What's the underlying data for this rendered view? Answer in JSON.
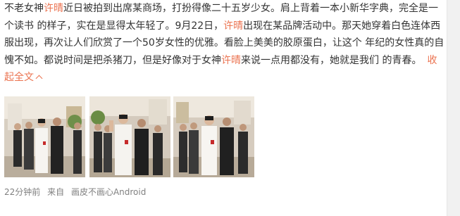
{
  "post": {
    "segments": [
      {
        "text": "不老女神",
        "type": "text"
      },
      {
        "text": "许晴",
        "type": "keyword"
      },
      {
        "text": "近日被拍到出席某商场，打扮得像二十五岁少女。肩上背着一本小新华字典，完全是一个读书 的样子，实在是显得太年轻了。9月22日，",
        "type": "text"
      },
      {
        "text": "许晴",
        "type": "keyword"
      },
      {
        "text": "出现在某品牌活动中。那天她穿着白色连体西服出现，再次让人们欣赏了一个50岁女性的优雅。看脸上美美的胶原蛋白，让这个 年纪的女性真的自愧不如。都说时间是把杀猪刀，但是好像对于女神",
        "type": "text"
      },
      {
        "text": "许晴",
        "type": "keyword"
      },
      {
        "text": "来说一点用都没有，她就是我们 的青春。",
        "type": "text"
      }
    ],
    "collapse_label": "收起全文",
    "images": [
      {
        "name": "photo-1",
        "alt": "event photo 1"
      },
      {
        "name": "photo-2",
        "alt": "event photo 2"
      },
      {
        "name": "photo-3",
        "alt": "event photo 3"
      }
    ]
  },
  "meta": {
    "time": "22分钟前",
    "source_prefix": "来自",
    "source": "画皮不画心Android"
  },
  "colors": {
    "keyword": "#eb7350",
    "text": "#333333",
    "meta": "#808080"
  }
}
